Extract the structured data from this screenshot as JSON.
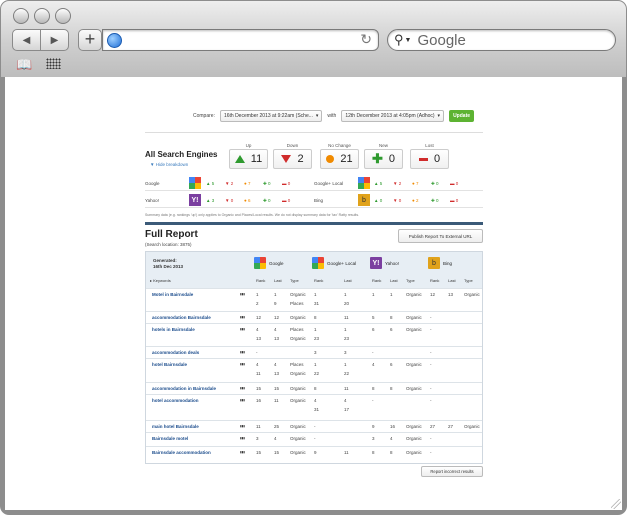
{
  "browser": {
    "search_placeholder": "Google",
    "url": ""
  },
  "compare": {
    "label": "Compare:",
    "from": "16th December 2013 at 9:22am (Sche...",
    "with_label": "with",
    "to": "12th December 2013 at 4:05pm (Adhoc)",
    "update": "Update"
  },
  "summary": {
    "title": "All Search Engines",
    "hide": "▼ Hide breakdown",
    "boxes": [
      {
        "label": "Up",
        "value": "11",
        "icon": "arrow-up-icon"
      },
      {
        "label": "Down",
        "value": "2",
        "icon": "arrow-down-icon"
      },
      {
        "label": "No Change",
        "value": "21",
        "icon": "dot-icon"
      },
      {
        "label": "New",
        "value": "0",
        "icon": "plus-icon"
      },
      {
        "label": "Lost",
        "value": "0",
        "icon": "minus-icon"
      }
    ],
    "rows": [
      {
        "engine": "Google",
        "up": "5",
        "down": "2",
        "same": "7",
        "new": "0",
        "lost": "0",
        "engine2": "Google+ Local",
        "up2": "5",
        "down2": "2",
        "same2": "7",
        "new2": "0",
        "lost2": "0"
      },
      {
        "engine": "Yahoo!",
        "up": "3",
        "down": "0",
        "same": "6",
        "new": "0",
        "lost": "0",
        "engine2": "Bing",
        "up2": "0",
        "down2": "0",
        "same2": "2",
        "new2": "0",
        "lost2": "0"
      }
    ],
    "note": "Summary data (e.g. rankings 'up') only applies to Organic and Places/Local results. We do not display summary data for 'tax' Ratty results."
  },
  "report": {
    "title": "Full Report",
    "location": "(Search location: 3875)",
    "publish": "Publish Report To External URL",
    "generated_label": "Generated:",
    "generated_date": "16th Dec 2013",
    "keywords_header": "Keywords",
    "engines": [
      "Google",
      "Google+ Local",
      "Yahoo!",
      "Bing"
    ],
    "col_rank": "Rank",
    "col_last": "Last",
    "col_type": "Type",
    "rows": [
      {
        "kw": "Motel in Bairnsdale",
        "lines": [
          [
            "1",
            "1",
            "Organic",
            "1",
            "1",
            "1",
            "1",
            "Organic",
            "12",
            "13",
            "Organic"
          ],
          [
            "2",
            "9",
            "Places",
            "31",
            "20",
            "",
            "",
            "",
            "",
            "",
            ""
          ]
        ]
      },
      {
        "kw": "accommodation Bairnsdale",
        "lines": [
          [
            "12",
            "12",
            "Organic",
            "8",
            "11",
            "5",
            "8",
            "Organic",
            "-",
            "",
            ""
          ]
        ]
      },
      {
        "kw": "hotels in Bairnsdale",
        "lines": [
          [
            "4",
            "4",
            "Places",
            "1",
            "1",
            "6",
            "6",
            "Organic",
            "-",
            "",
            ""
          ],
          [
            "13",
            "13",
            "Organic",
            "23",
            "23",
            "",
            "",
            "",
            "",
            "",
            ""
          ]
        ]
      },
      {
        "kw": "accommodation deals",
        "lines": [
          [
            "-",
            "",
            "",
            "3",
            "3",
            "-",
            "",
            "",
            "-",
            "",
            ""
          ]
        ]
      },
      {
        "kw": "hotel Bairnsdale",
        "lines": [
          [
            "4",
            "4",
            "Places",
            "1",
            "1",
            "4",
            "6",
            "Organic",
            "-",
            "",
            ""
          ],
          [
            "11",
            "13",
            "Organic",
            "22",
            "22",
            "",
            "",
            "",
            "",
            "",
            ""
          ]
        ]
      },
      {
        "kw": "accommodation in Bairnsdale",
        "lines": [
          [
            "15",
            "15",
            "Organic",
            "8",
            "11",
            "8",
            "8",
            "Organic",
            "-",
            "",
            ""
          ]
        ]
      },
      {
        "kw": "hotel accommodation",
        "lines": [
          [
            "16",
            "11",
            "Organic",
            "4",
            "4",
            "-",
            "",
            "",
            "-",
            "",
            ""
          ],
          [
            "",
            "",
            "",
            "31",
            "17",
            "",
            "",
            "",
            "",
            "",
            ""
          ]
        ]
      },
      {
        "kw": "main hotel Bairnsdale",
        "lines": [
          [
            "11",
            "25",
            "Organic",
            "-",
            "",
            "9",
            "16",
            "Organic",
            "27",
            "27",
            "Organic"
          ]
        ]
      },
      {
        "kw": "Bairnsdale motel",
        "lines": [
          [
            "3",
            "4",
            "Organic",
            "-",
            "",
            "3",
            "4",
            "Organic",
            "-",
            "",
            ""
          ]
        ]
      },
      {
        "kw": "Bairnsdale accommodation",
        "lines": [
          [
            "15",
            "15",
            "Organic",
            "9",
            "11",
            "8",
            "8",
            "Organic",
            "-",
            "",
            ""
          ]
        ]
      }
    ],
    "report_button": "Report incorrect results"
  }
}
